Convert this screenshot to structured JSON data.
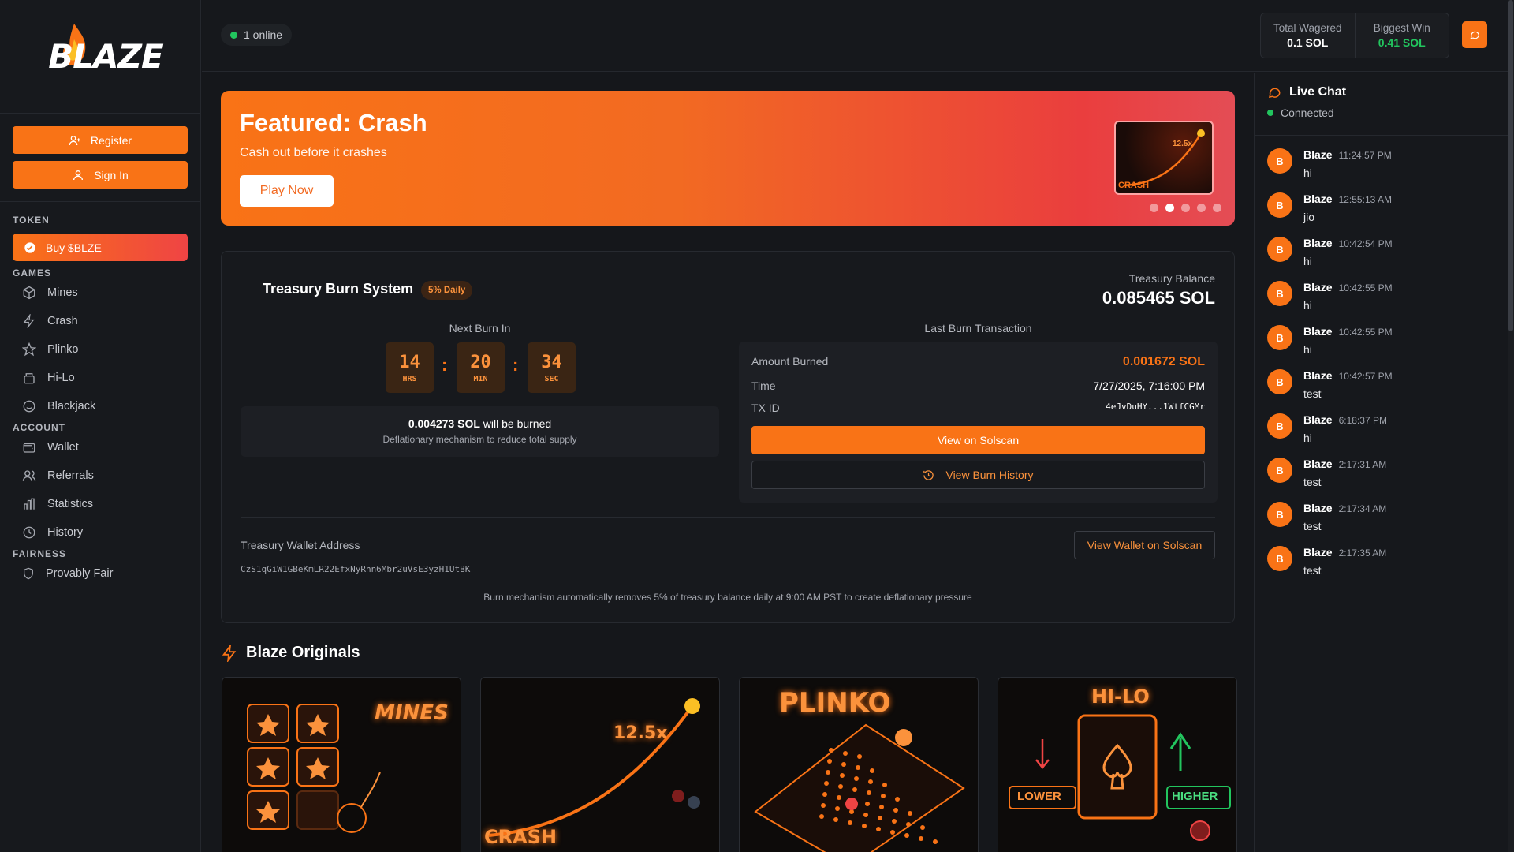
{
  "brand": {
    "logo_text": "BLAZE"
  },
  "sidebar": {
    "register": "Register",
    "sign_in": "Sign In",
    "token_title": "TOKEN",
    "buy": "Buy $BLZE",
    "games_title": "GAMES",
    "games": [
      {
        "label": "Mines",
        "icon": "cube-icon"
      },
      {
        "label": "Crash",
        "icon": "bolt-icon"
      },
      {
        "label": "Plinko",
        "icon": "star-icon"
      },
      {
        "label": "Hi-Lo",
        "icon": "cards-icon"
      },
      {
        "label": "Blackjack",
        "icon": "smile-icon"
      }
    ],
    "account_title": "ACCOUNT",
    "account": [
      {
        "label": "Wallet",
        "icon": "wallet-icon"
      },
      {
        "label": "Referrals",
        "icon": "users-icon"
      },
      {
        "label": "Statistics",
        "icon": "bar-chart-icon"
      },
      {
        "label": "History",
        "icon": "clock-icon"
      }
    ],
    "fairness_title": "FAIRNESS",
    "fairness": [
      {
        "label": "Provably Fair",
        "icon": "shield-icon"
      }
    ]
  },
  "header": {
    "online": "1 online",
    "wagered_label": "Total Wagered",
    "wagered_value": "0.1 SOL",
    "biggest_label": "Biggest Win",
    "biggest_value": "0.41 SOL"
  },
  "banner": {
    "title": "Featured: Crash",
    "subtitle": "Cash out before it crashes",
    "cta": "Play Now",
    "thumb_label": "CRASH",
    "thumb_multiplier": "12.5x",
    "slides": 5,
    "active_slide": 2
  },
  "treasury": {
    "title": "Treasury Burn System",
    "badge": "5% Daily",
    "balance_label": "Treasury Balance",
    "balance_value": "0.085465 SOL",
    "next_burn_label": "Next Burn In",
    "countdown": [
      {
        "n": "14",
        "u": "HRS"
      },
      {
        "n": "20",
        "u": "MIN"
      },
      {
        "n": "34",
        "u": "SEC"
      }
    ],
    "burn_amount": "0.004273 SOL",
    "burn_suffix": " will be burned",
    "burn_desc": "Deflationary mechanism to reduce total supply",
    "last_label": "Last Burn Transaction",
    "amount_label": "Amount Burned",
    "amount_value": "0.001672 SOL",
    "time_label": "Time",
    "time_value": "7/27/2025, 7:16:00 PM",
    "tx_label": "TX ID",
    "tx_value": "4eJvDuHY...1WtfCGMr",
    "solscan": "View on Solscan",
    "history": "View Burn History",
    "wallet_label": "Treasury Wallet Address",
    "wallet_value": "CzS1qGiW1GBeKmLR22EfxNyRnn6Mbr2uVsE3yzH1UtBK",
    "view_wallet": "View Wallet on Solscan",
    "note": "Burn mechanism automatically removes 5% of treasury balance daily at 9:00 AM PST to create deflationary pressure"
  },
  "originals": {
    "title": "Blaze Originals",
    "cards": [
      {
        "label": "MINES"
      },
      {
        "label": "CRASH",
        "extra": "12.5x"
      },
      {
        "label": "PLINKO"
      },
      {
        "label": "HI-LO",
        "lower": "LOWER",
        "higher": "HIGHER"
      }
    ]
  },
  "chat": {
    "title": "Live Chat",
    "status": "Connected",
    "messages": [
      {
        "avatar": "B",
        "user": "Blaze",
        "time": "11:24:57 PM",
        "text": "hi"
      },
      {
        "avatar": "B",
        "user": "Blaze",
        "time": "12:55:13 AM",
        "text": "jio"
      },
      {
        "avatar": "B",
        "user": "Blaze",
        "time": "10:42:54 PM",
        "text": "hi"
      },
      {
        "avatar": "B",
        "user": "Blaze",
        "time": "10:42:55 PM",
        "text": "hi"
      },
      {
        "avatar": "B",
        "user": "Blaze",
        "time": "10:42:55 PM",
        "text": "hi"
      },
      {
        "avatar": "B",
        "user": "Blaze",
        "time": "10:42:57 PM",
        "text": "test"
      },
      {
        "avatar": "B",
        "user": "Blaze",
        "time": "6:18:37 PM",
        "text": "hi"
      },
      {
        "avatar": "B",
        "user": "Blaze",
        "time": "2:17:31 AM",
        "text": "test"
      },
      {
        "avatar": "B",
        "user": "Blaze",
        "time": "2:17:34 AM",
        "text": "test"
      },
      {
        "avatar": "B",
        "user": "Blaze",
        "time": "2:17:35 AM",
        "text": "test"
      }
    ]
  },
  "colors": {
    "accent": "#f97316",
    "online": "#22c55e",
    "danger": "#ef4444"
  }
}
